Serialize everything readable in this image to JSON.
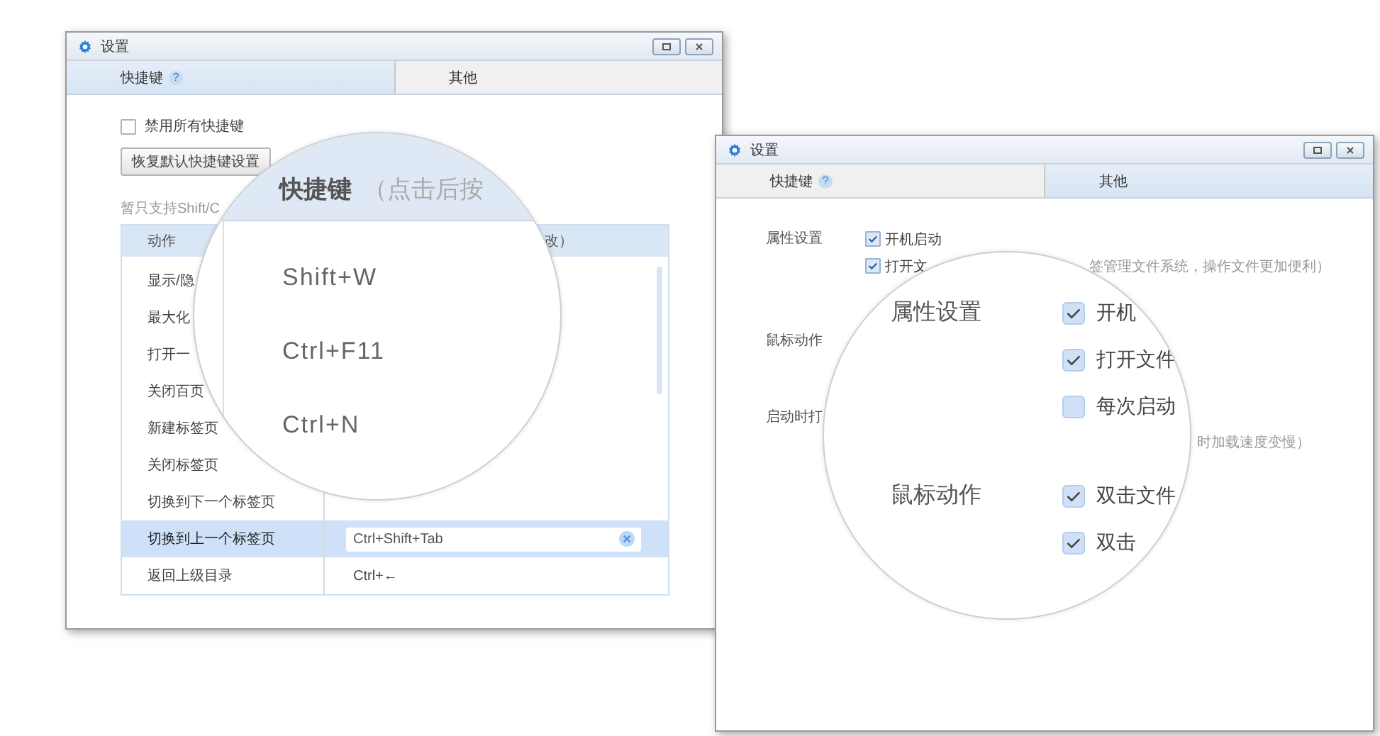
{
  "shortcut_window": {
    "title": "设置",
    "tabs": [
      {
        "label": "快捷键",
        "help": "?",
        "selected": true
      },
      {
        "label": "其他",
        "selected": false
      }
    ],
    "disable_all": {
      "label": "禁用所有快捷键",
      "checked": false
    },
    "restore_button": "恢复默认快捷键设置",
    "hint": "暂只支持Shift/C",
    "columns": [
      "动作",
      "改）"
    ],
    "rows": [
      {
        "action": "显示/隐",
        "selected": false
      },
      {
        "action": "最大化",
        "selected": false
      },
      {
        "action": "打开一",
        "selected": false
      },
      {
        "action": "关闭百页",
        "selected": false
      },
      {
        "action": "新建标签页",
        "selected": false
      },
      {
        "action": "关闭标签页",
        "selected": false
      },
      {
        "action": "切换到下一个标签页",
        "selected": false
      },
      {
        "action": "切换到上一个标签页",
        "key": "Ctrl+Shift+Tab",
        "selected": true
      },
      {
        "action": "返回上级目录",
        "key": "Ctrl+←",
        "selected": false
      }
    ]
  },
  "shortcut_magnifier": {
    "heading": "快捷键",
    "heading_note": "（点击后按",
    "keys": [
      "Shift+W",
      "Ctrl+F11",
      "Ctrl+N"
    ]
  },
  "other_window": {
    "title": "设置",
    "tabs": [
      {
        "label": "快捷键",
        "help": "?",
        "selected": false
      },
      {
        "label": "其他",
        "selected": true
      }
    ],
    "sections": [
      {
        "label": "属性设置",
        "items": [
          {
            "label": "开机启动",
            "checked": true
          },
          {
            "label": "打开文",
            "note": "签管理文件系统，操作文件更加便利）",
            "checked": true
          }
        ]
      },
      {
        "label": "鼠标动作"
      },
      {
        "label": "启动时打",
        "note": "时加载速度变慢）"
      }
    ]
  },
  "other_magnifier": {
    "sections": [
      {
        "label": "属性设置",
        "items": [
          {
            "label": "开机",
            "checked": true
          },
          {
            "label": "打开文件",
            "checked": true
          },
          {
            "label": "每次启动",
            "checked": false
          }
        ]
      },
      {
        "label": "鼠标动作",
        "items": [
          {
            "label": "双击文件",
            "checked": true
          },
          {
            "label": "双击",
            "checked": true
          }
        ]
      }
    ]
  }
}
